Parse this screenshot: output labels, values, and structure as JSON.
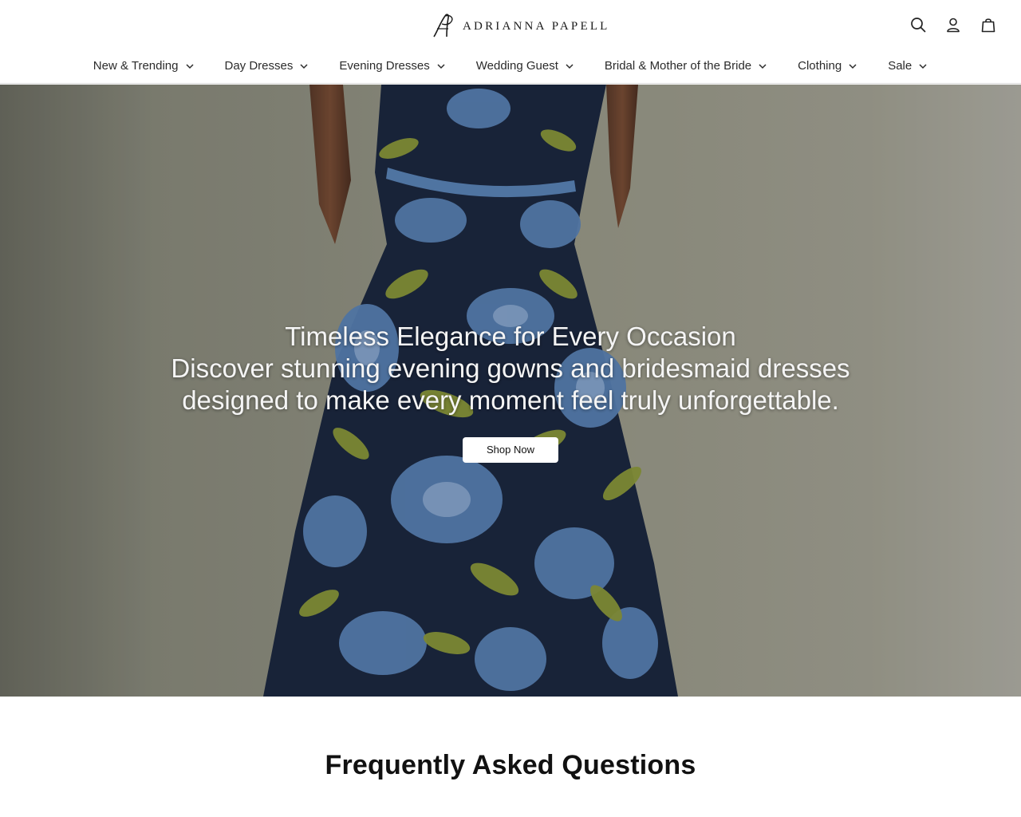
{
  "brand": {
    "name": "ADRIANNA PAPELL"
  },
  "header": {
    "icons": [
      "search-icon",
      "account-icon",
      "bag-icon"
    ]
  },
  "nav": {
    "items": [
      {
        "label": "New & Trending"
      },
      {
        "label": "Day Dresses"
      },
      {
        "label": "Evening Dresses"
      },
      {
        "label": "Wedding Guest"
      },
      {
        "label": "Bridal & Mother of the Bride"
      },
      {
        "label": "Clothing"
      },
      {
        "label": "Sale"
      }
    ]
  },
  "hero": {
    "title": "Timeless Elegance for Every Occasion",
    "subtitle": "Discover stunning evening gowns and bridesmaid dresses designed to make every moment feel truly unforgettable.",
    "cta_label": "Shop Now"
  },
  "faq": {
    "heading": "Frequently Asked Questions"
  },
  "colors": {
    "text": "#1a1a1a",
    "hero_bg": "#8f9080",
    "dress_navy": "#1c2840",
    "flower_blue": "#5b84b8",
    "leaf_olive": "#8e9a3c"
  }
}
